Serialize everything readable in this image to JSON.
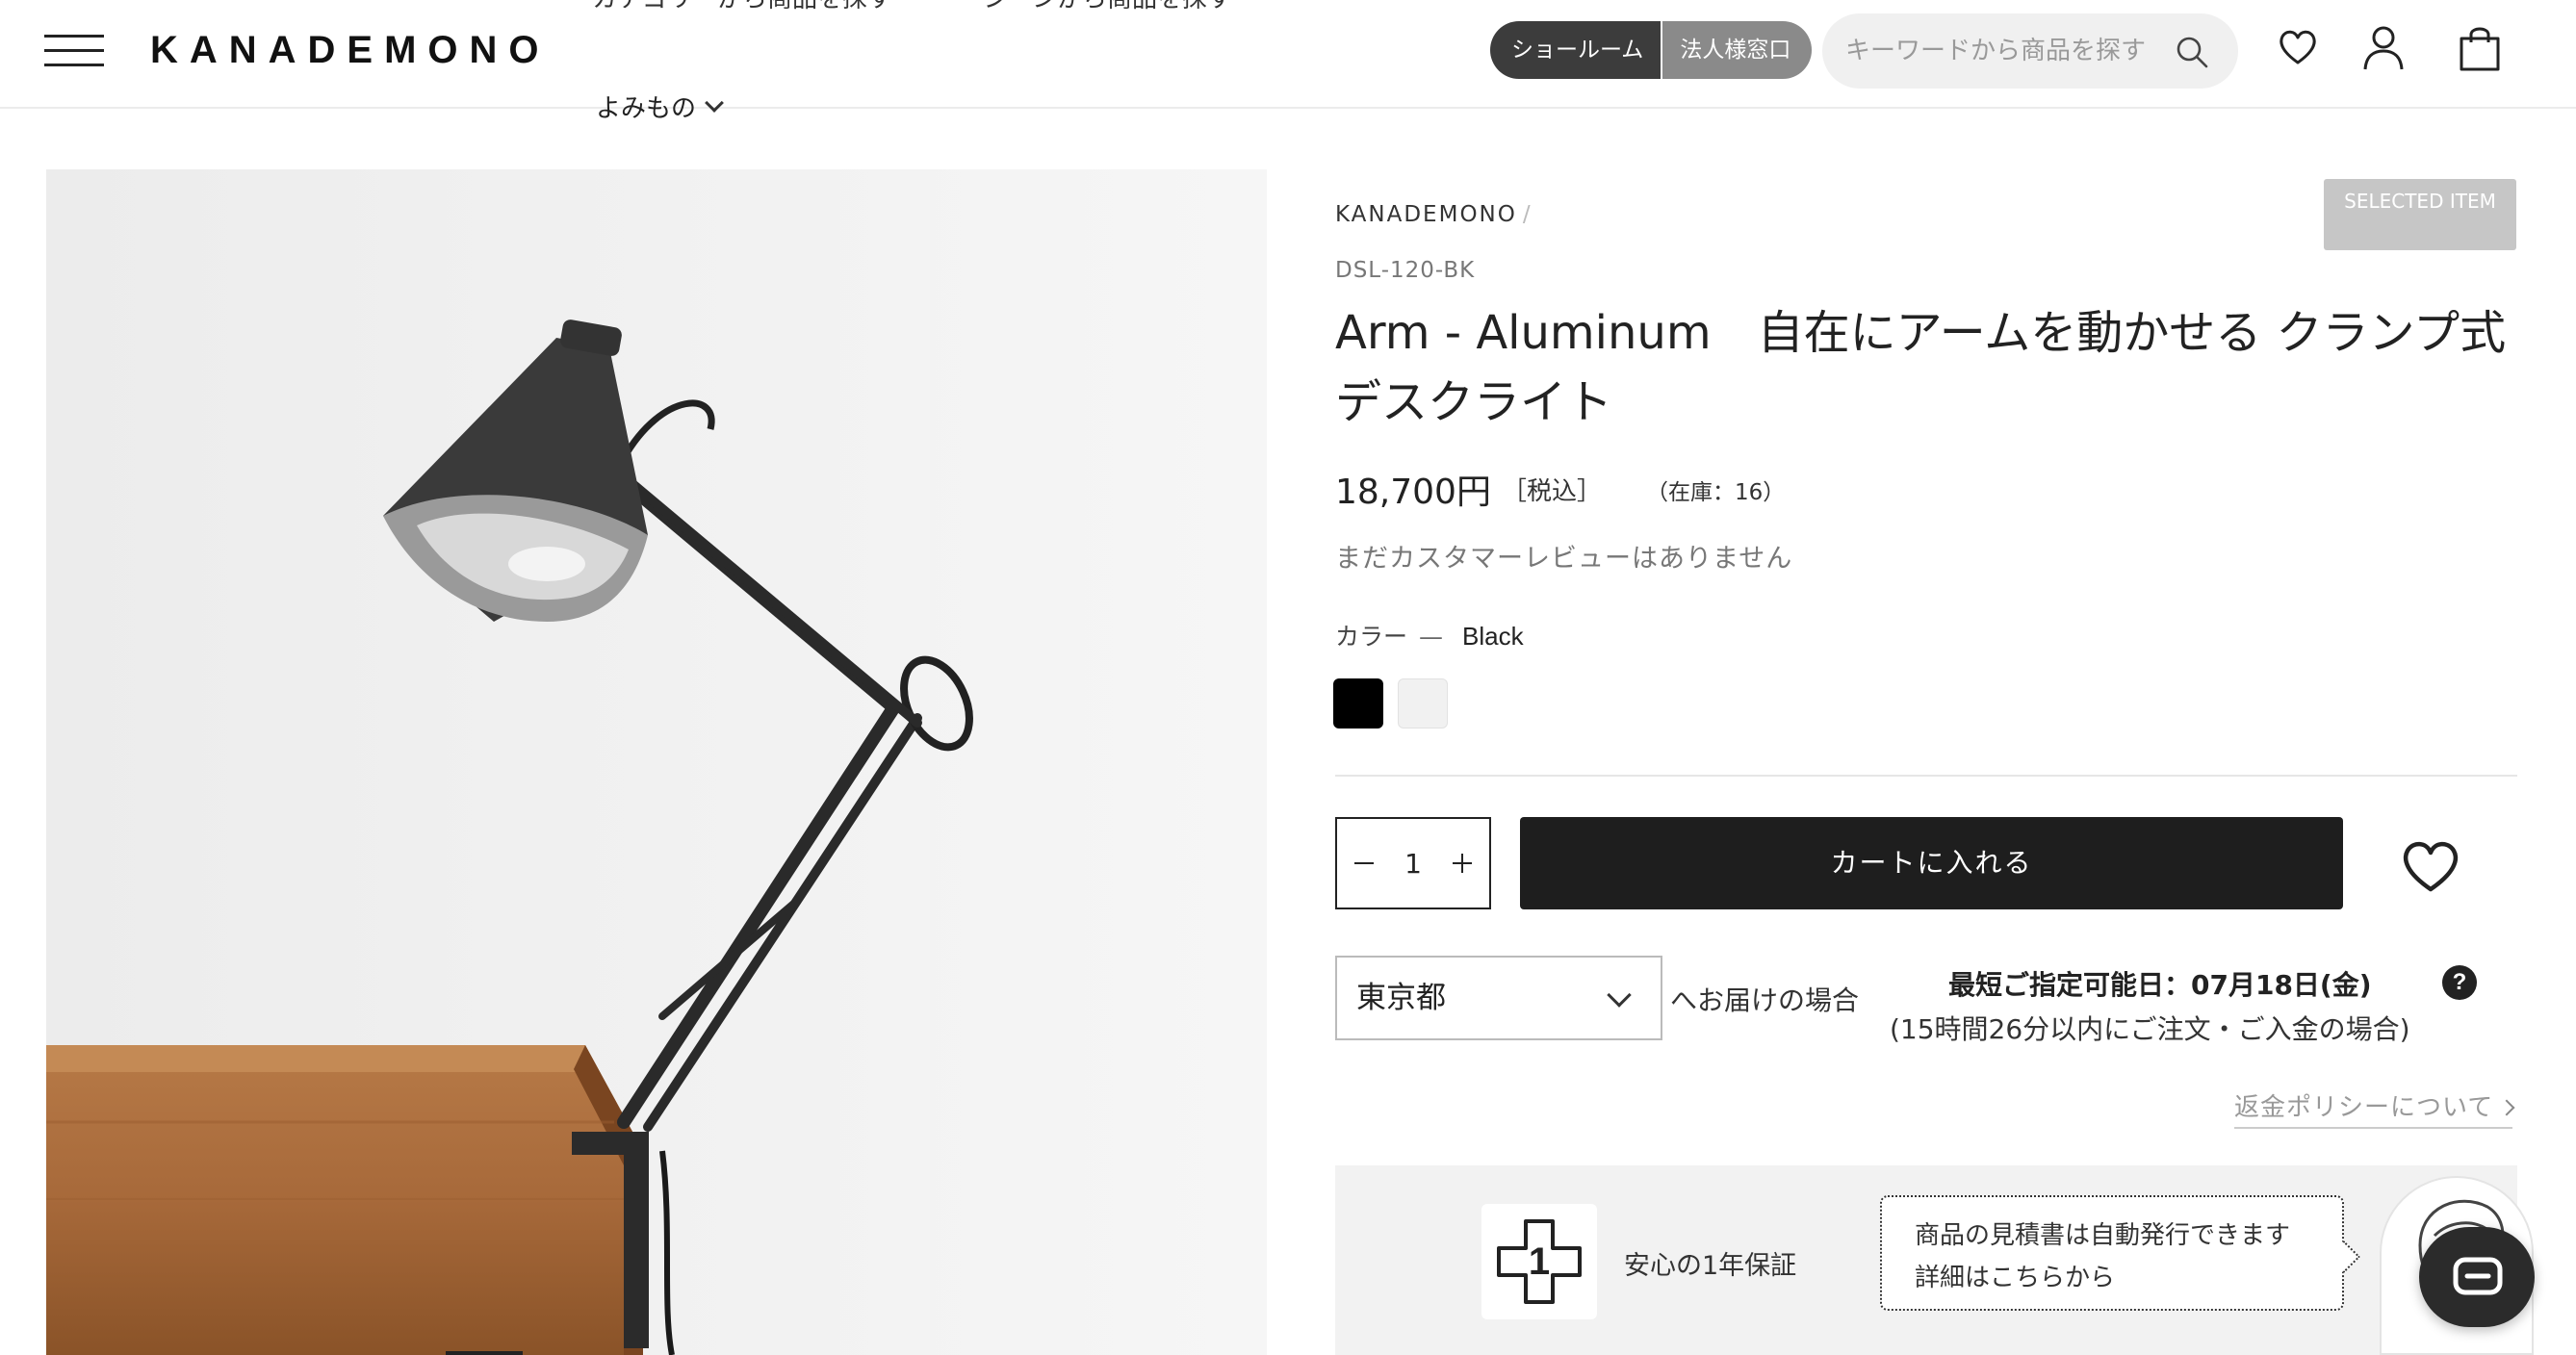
{
  "header": {
    "logo": "KANADEMONO",
    "partial_nav": [
      "カテゴリーから商品を探す",
      "シーンから商品を探す"
    ],
    "yomimono": "よみもの",
    "showroom": "ショールーム",
    "corporate": "法人様窓口",
    "search_placeholder": "キーワードから商品を探す"
  },
  "product": {
    "brand": "KANADEMONO",
    "brand_sep": "/",
    "badge": "SELECTED ITEM",
    "sku": "DSL-120-BK",
    "title": "Arm - Aluminum　自在にアームを動かせる クランプ式デスクライト",
    "price": "18,700円",
    "tax": "［税込］",
    "stock": "（在庫：16）",
    "review": "まだカスタマーレビューはありません",
    "color_label": "カラー",
    "color_dash": "—",
    "color_value": "Black",
    "swatches": [
      "#000000",
      "#f1f1f1"
    ],
    "quantity": "1",
    "add_to_cart": "カートに入れる"
  },
  "delivery": {
    "prefecture": "東京都",
    "suffix": "へお届けの場合",
    "soonest": "最短ご指定可能日：07月18日(金)",
    "within": "(15時間26分以内にご注文・ご入金の場合)",
    "help": "?",
    "refund_link": "返金ポリシーについて"
  },
  "banner": {
    "warranty_number": "1",
    "warranty_text": "安心の1年保証",
    "quote_line1": "商品の見積書は自動発行できます",
    "quote_line2": "詳細はこちらから"
  },
  "colors": {
    "accent_dark": "#1e1e1e",
    "showroom_bg": "#3c3c3c",
    "corporate_bg": "#8a8a8a",
    "badge_bg": "#c6c6c6"
  }
}
